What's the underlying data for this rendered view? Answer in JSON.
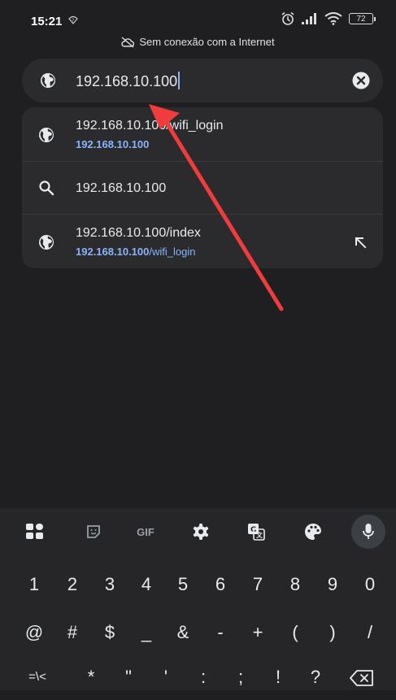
{
  "status": {
    "time": "15:21",
    "battery": "72"
  },
  "offline_banner": "Sem conexão com a Internet",
  "urlbar": {
    "value": "192.168.10.100"
  },
  "suggestions": [
    {
      "title": "192.168.10.100/wifi_login",
      "sub_bold": "192.168.10.100",
      "sub_rest": "",
      "icon": "globe-icon"
    },
    {
      "title": "192.168.10.100",
      "icon": "search-icon"
    },
    {
      "title": "192.168.10.100/index",
      "sub_bold": "192.168.10.100",
      "sub_rest": "/wifi_login",
      "icon": "globe-icon"
    }
  ],
  "keyboard": {
    "toolbar": {
      "gif": "GIF"
    },
    "row1": [
      "1",
      "2",
      "3",
      "4",
      "5",
      "6",
      "7",
      "8",
      "9",
      "0"
    ],
    "row2": [
      "@",
      "#",
      "$",
      "_",
      "&",
      "-",
      "+",
      "(",
      ")",
      "/"
    ],
    "row3": [
      "=\\<",
      "*",
      "\"",
      "'",
      ":",
      ";",
      "!",
      "?"
    ]
  },
  "colors": {
    "accent": "#8ab4f8",
    "annotation_arrow": "#f03c3c"
  }
}
